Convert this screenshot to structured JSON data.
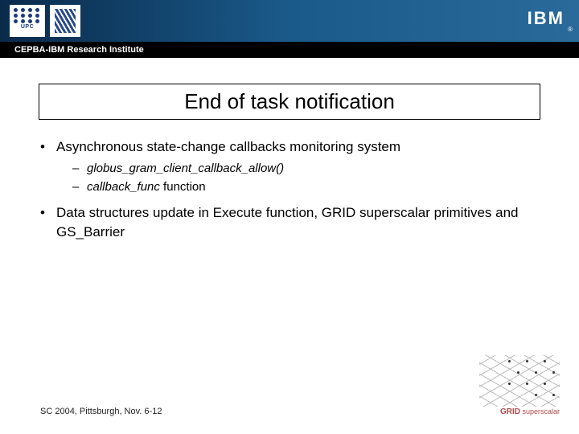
{
  "header": {
    "upc_text": "UPC",
    "ibm_text": "IBM",
    "reg": "®",
    "sub_bar": "CEPBA-IBM Research Institute"
  },
  "title": "End of task notification",
  "bullets": [
    {
      "text": "Asynchronous state-change callbacks monitoring system",
      "subs": [
        {
          "italic": "globus_gram_client_callback_allow()",
          "rest": ""
        },
        {
          "italic": "callback_func",
          "rest": " function"
        }
      ]
    },
    {
      "text": "Data structures update in Execute function, GRID superscalar primitives and GS_Barrier",
      "subs": []
    }
  ],
  "footer": "SC 2004, Pittsburgh, Nov. 6-12",
  "grid_logo": {
    "word": "GRID",
    "sub": "superscalar"
  }
}
